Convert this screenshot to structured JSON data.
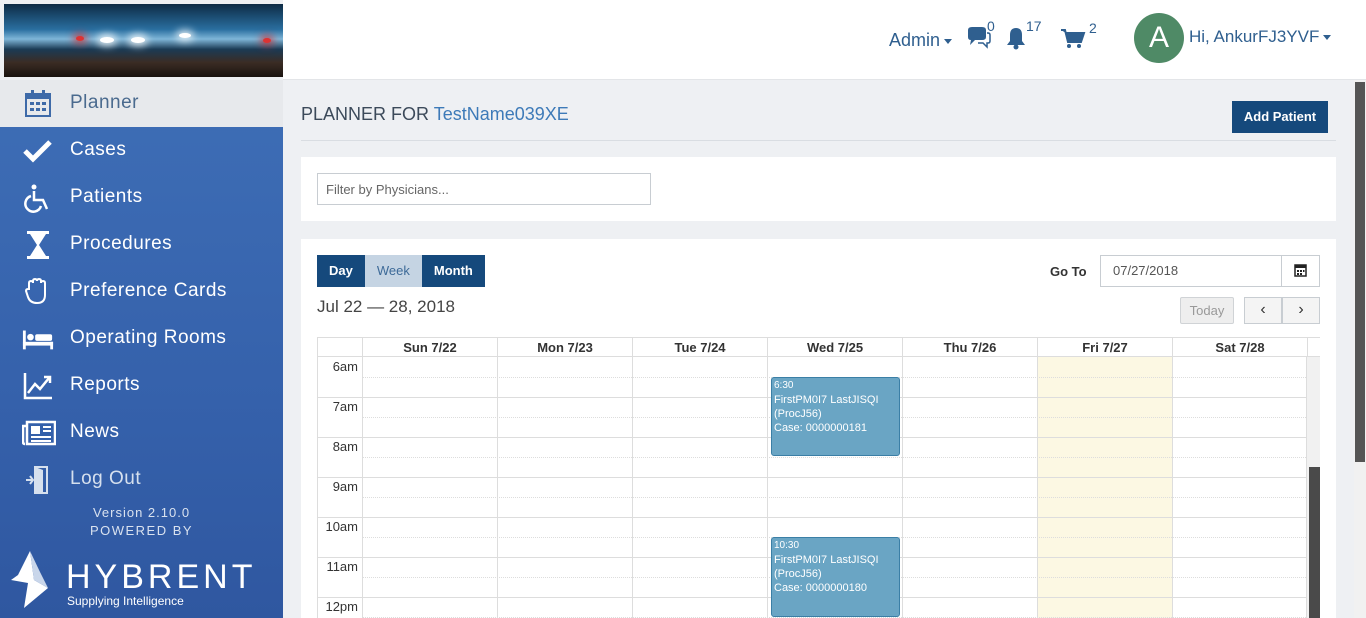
{
  "header": {
    "admin_label": "Admin",
    "messages_count": "0",
    "notifications_count": "17",
    "cart_count": "2",
    "avatar_initial": "A",
    "user_label": "Hi, AnkurFJ3YVF"
  },
  "sidebar": {
    "items": [
      {
        "label": "Planner",
        "icon": "calendar-icon"
      },
      {
        "label": "Cases",
        "icon": "checkmark-icon"
      },
      {
        "label": "Patients",
        "icon": "wheelchair-icon"
      },
      {
        "label": "Procedures",
        "icon": "hourglass-icon"
      },
      {
        "label": "Preference Cards",
        "icon": "glove-icon"
      },
      {
        "label": "Operating Rooms",
        "icon": "bed-icon"
      },
      {
        "label": "Reports",
        "icon": "chart-line-icon"
      },
      {
        "label": "News",
        "icon": "newspaper-icon"
      },
      {
        "label": "Log Out",
        "icon": "door-exit-icon"
      }
    ],
    "version": "Version 2.10.0",
    "powered_by": "POWERED BY",
    "brand_name": "HYBRENT",
    "brand_tagline": "Supplying Intelligence"
  },
  "page": {
    "title_prefix": "PLANNER FOR",
    "title_name": "TestName039XE",
    "add_patient_label": "Add Patient",
    "filter_placeholder": "Filter by Physicians..."
  },
  "calendar": {
    "views": [
      "Day",
      "Week",
      "Month"
    ],
    "active_view": "Week",
    "range_label": "Jul 22 — 28, 2018",
    "goto_label": "Go To",
    "goto_value": "07/27/2018",
    "today_label": "Today",
    "prev_label": "‹",
    "next_label": "›",
    "days": [
      "Sun 7/22",
      "Mon 7/23",
      "Tue 7/24",
      "Wed 7/25",
      "Thu 7/26",
      "Fri 7/27",
      "Sat 7/28"
    ],
    "highlight_day": "Fri 7/27",
    "times": [
      "6am",
      "7am",
      "8am",
      "9am",
      "10am",
      "11am",
      "12pm"
    ],
    "events": [
      {
        "day": "Wed 7/25",
        "time": "6:30",
        "name": "FirstPM0I7 LastJISQI",
        "proc": "(ProcJ56)",
        "case": "Case: 0000000181"
      },
      {
        "day": "Wed 7/25",
        "time": "10:30",
        "name": "FirstPM0I7 LastJISQI",
        "proc": "(ProcJ56)",
        "case": "Case: 0000000180"
      }
    ]
  },
  "colors": {
    "sidebar": "#3561ab",
    "primary_button": "#15497c",
    "event": "#6aa5c4",
    "today_highlight": "#fcf8e3",
    "avatar": "#4f8a66"
  }
}
